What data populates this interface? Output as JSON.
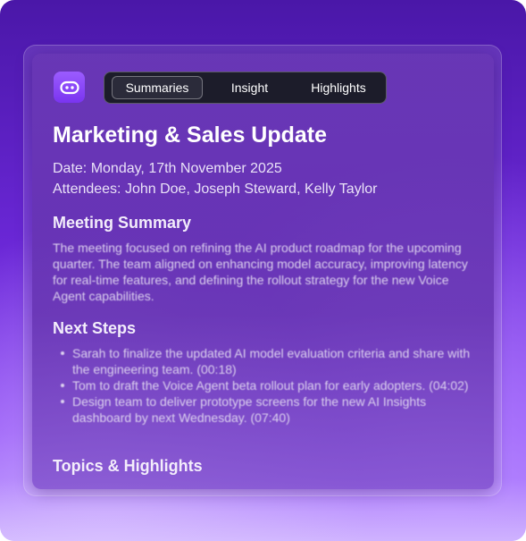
{
  "tabs": [
    {
      "label": "Summaries",
      "active": true
    },
    {
      "label": "Insight",
      "active": false
    },
    {
      "label": "Highlights",
      "active": false
    }
  ],
  "app_icon": {
    "name": "robot-icon"
  },
  "meeting": {
    "title": "Marketing & Sales Update",
    "date": "Date: Monday, 17th November 2025",
    "attendees": "Attendees: John Doe, Joseph Steward, Kelly Taylor"
  },
  "summary": {
    "heading": "Meeting Summary",
    "text": "The meeting focused on refining the AI product roadmap for the upcoming quarter. The team aligned on enhancing model accuracy, improving latency for real-time features, and defining the rollout strategy for the new Voice Agent capabilities."
  },
  "next_steps": {
    "heading": "Next Steps",
    "items": [
      "Sarah to finalize the updated AI model evaluation criteria and share with the engineering team. (00:18)",
      "Tom to draft the Voice Agent beta rollout plan for early adopters. (04:02)",
      "Design team to deliver prototype screens for the new AI Insights dashboard by next Wednesday. (07:40)"
    ]
  },
  "topics": {
    "heading": "Topics & Highlights"
  },
  "colors": {
    "accent": "#8a45f7",
    "tab_bar": "#1c1c2a"
  }
}
